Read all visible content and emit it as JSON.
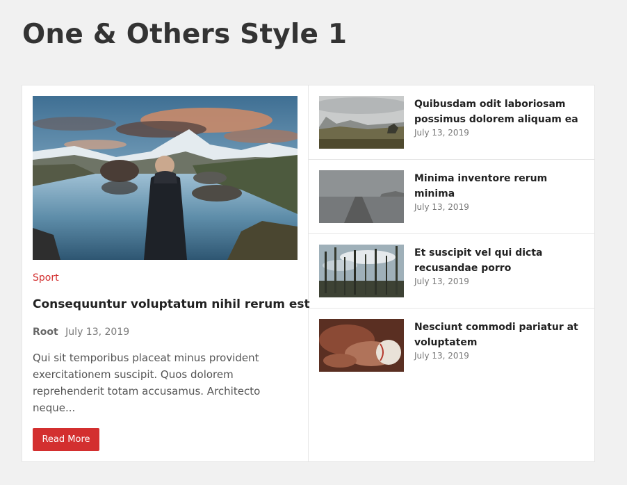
{
  "page": {
    "title": "One & Others Style 1"
  },
  "featured": {
    "category": "Sport",
    "title": "Consequuntur voluptatum nihil rerum est",
    "author": "Root",
    "date": "July 13, 2019",
    "excerpt": "Qui sit temporibus placeat minus provident exercitationem suscipit. Quos dolorem reprehenderit totam accusamus. Architecto neque...",
    "read_more": "Read More",
    "accent_color": "#d32f2f"
  },
  "posts": [
    {
      "title": "Quibusdam odit laboriosam possimus dolorem aliquam ea",
      "date": "July 13, 2019"
    },
    {
      "title": "Minima inventore rerum minima",
      "date": "July 13, 2019"
    },
    {
      "title": "Et suscipit vel qui dicta recusandae porro",
      "date": "July 13, 2019"
    },
    {
      "title": "Nesciunt commodi pariatur at voluptatem",
      "date": "July 13, 2019"
    }
  ]
}
